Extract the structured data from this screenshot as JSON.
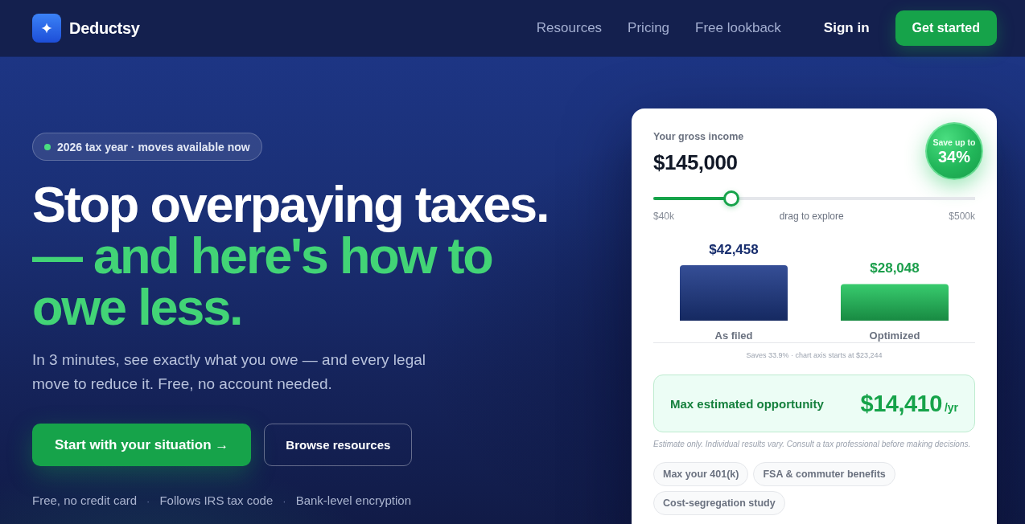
{
  "nav": {
    "brand": "Deductsy",
    "links": [
      "Resources",
      "Pricing",
      "Free lookback"
    ],
    "sign_in": "Sign in",
    "cta": "Get started"
  },
  "hero": {
    "badge": "2026 tax year · moves available now",
    "headline": "Stop overpaying taxes.",
    "headline_accent": "— and here's how to owe less.",
    "subtitle": "In 3 minutes, see exactly what you owe — and every legal move to reduce it. Free, no account needed.",
    "primary_button": "Start with your situation →",
    "secondary_button": "Browse resources",
    "trust": {
      "items": [
        "Free, no credit card",
        "Follows IRS tax code",
        "Bank-level encryption"
      ],
      "separator": "·"
    }
  },
  "calculator": {
    "savings": {
      "caption": "Save up to",
      "value": "34%"
    },
    "income": {
      "label": "Your gross income",
      "value": "$145,000",
      "level": 0.228,
      "min_label": "$40k",
      "hint": "drag to explore",
      "max_label": "$500k"
    },
    "chart": {
      "chart_data": {
        "type": "bar",
        "categories": [
          "As filed",
          "Optimized"
        ],
        "series": [
          {
            "color": "#1e3a8a",
            "values": [
              42458,
              null
            ],
            "value_labels": [
              "$42,458",
              null
            ]
          },
          {
            "color": "#22c55e",
            "values": [
              null,
              28048
            ],
            "value_labels": [
              null,
              "$28,048"
            ]
          }
        ]
      },
      "note": "Saves 33.9% · chart axis starts at $23,244"
    },
    "opportunity": {
      "label": "Max estimated opportunity",
      "amount": "$14,410",
      "unit": "/yr"
    },
    "disclaimer": "Estimate only. Individual results vary. Consult a tax professional before making decisions.",
    "strategies": [
      "Max your 401(k)",
      "FSA & commuter benefits",
      "Cost-segregation study"
    ]
  }
}
